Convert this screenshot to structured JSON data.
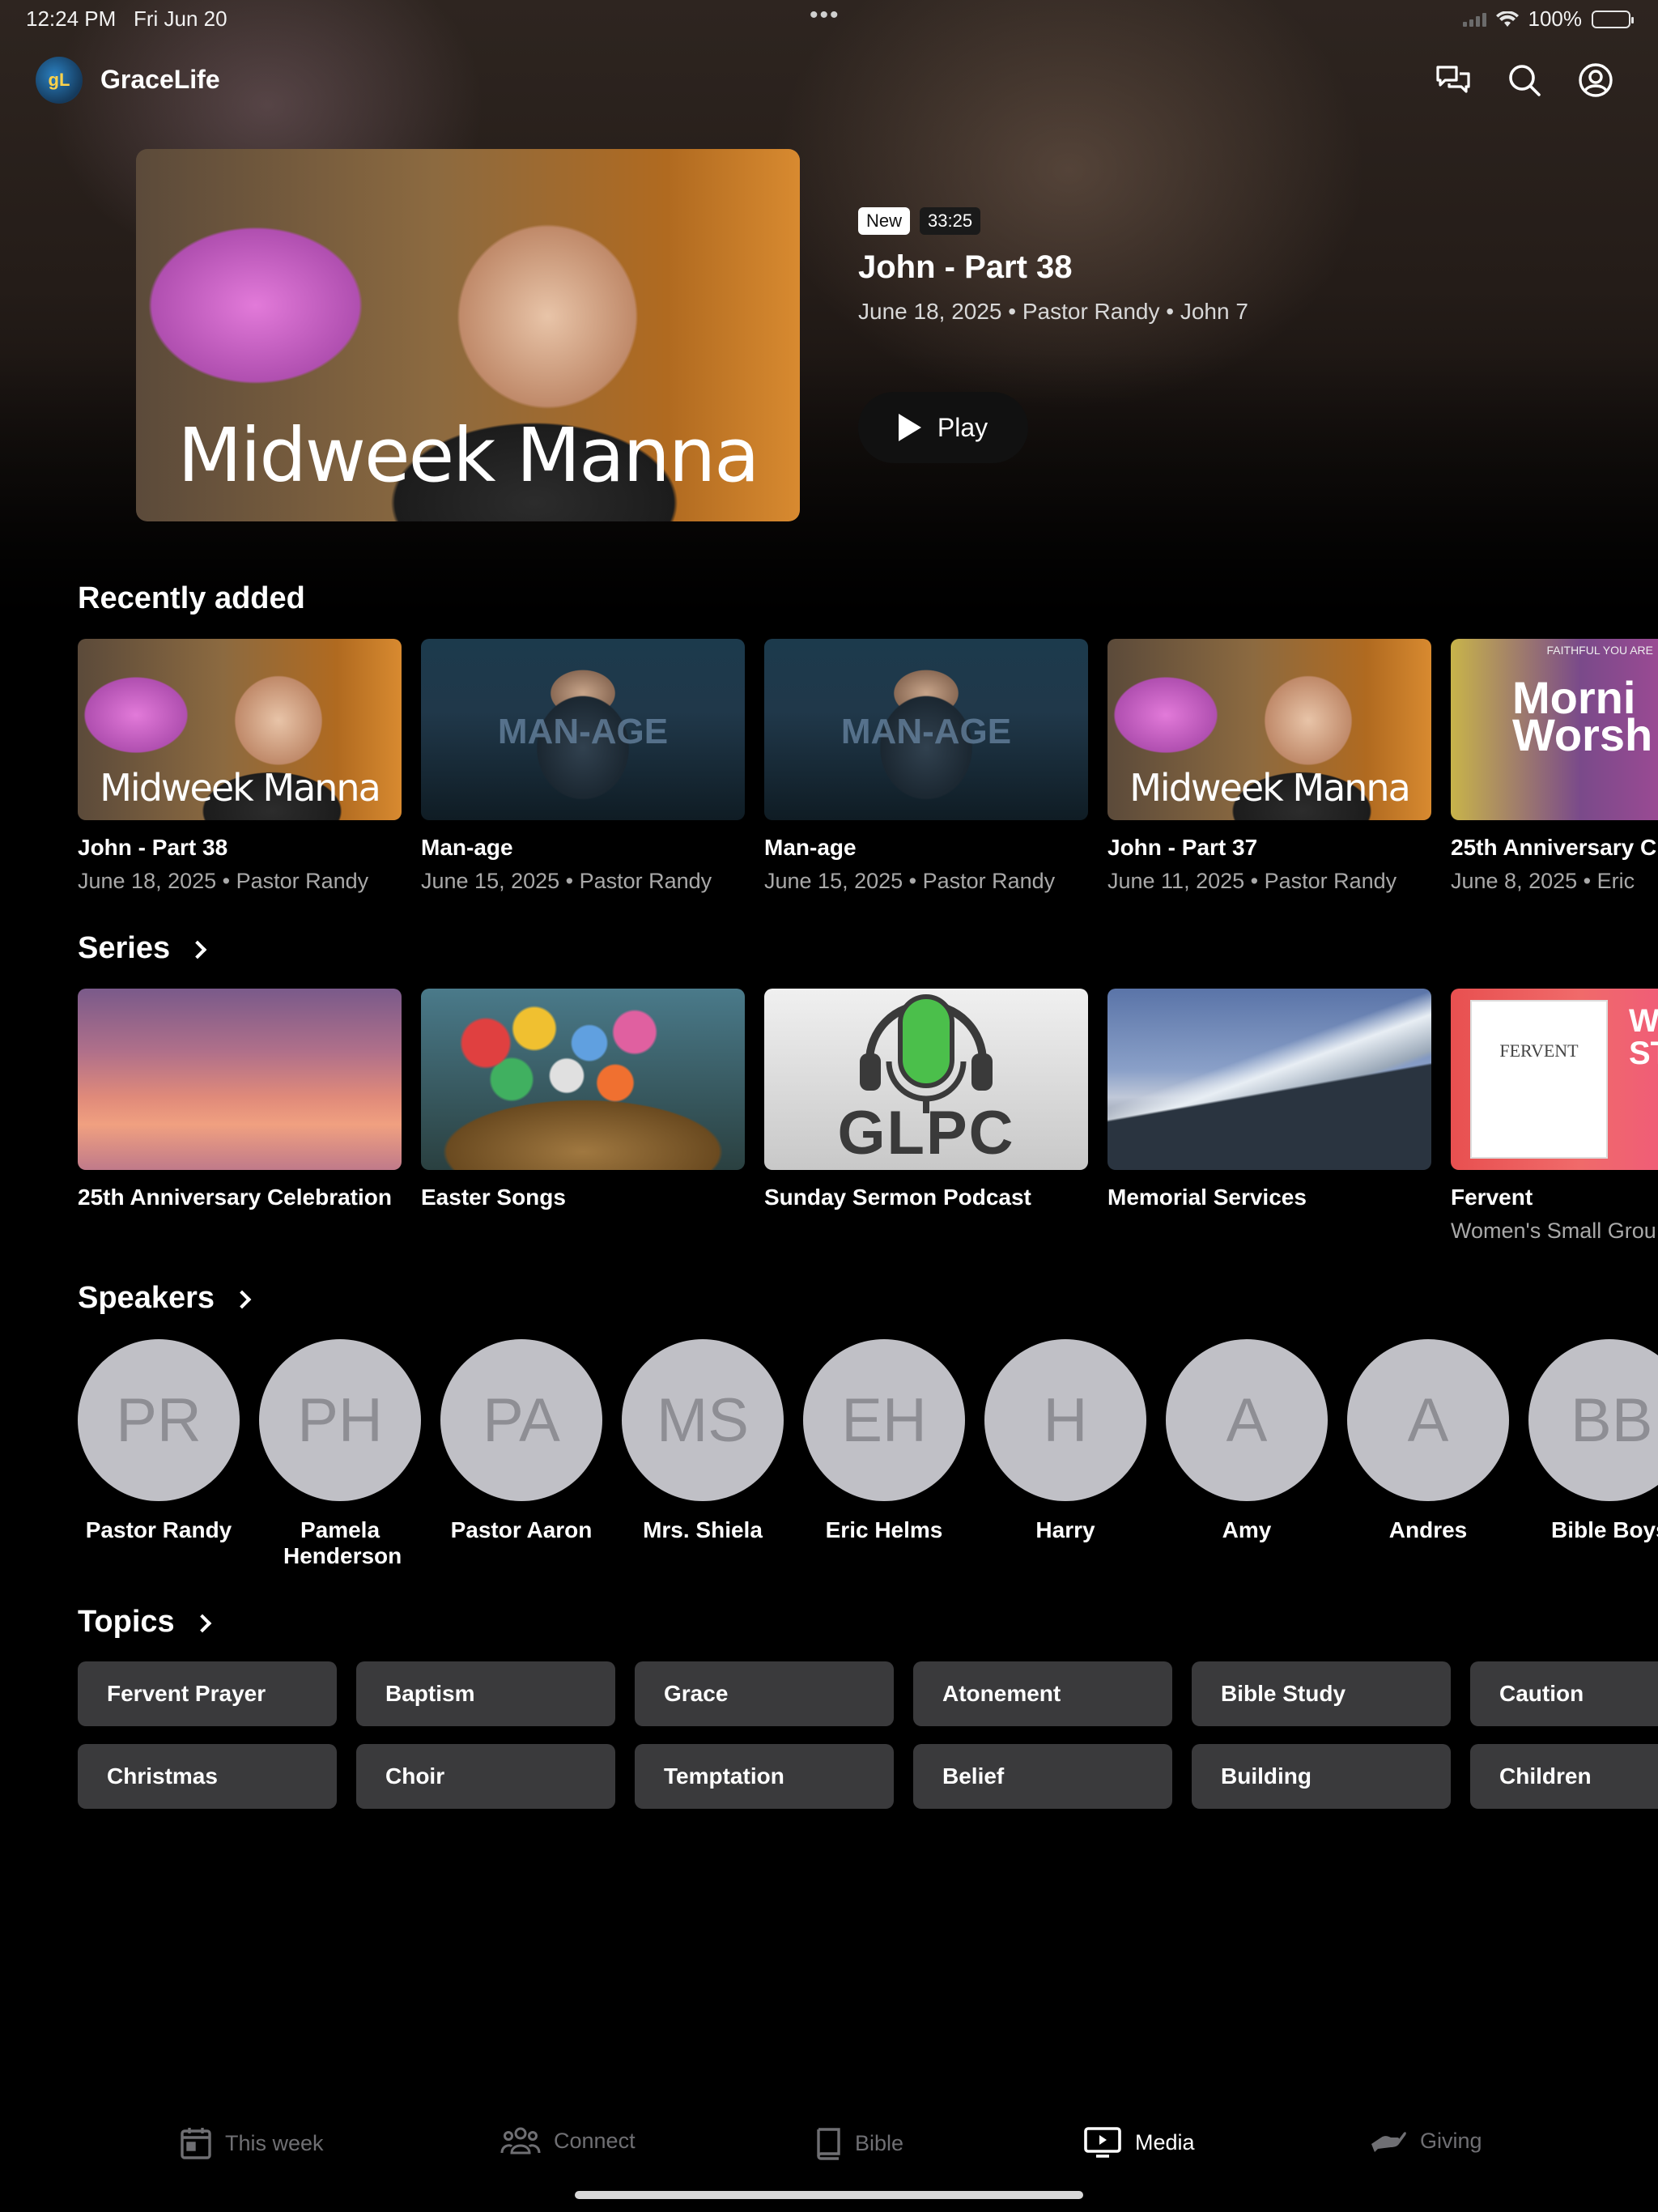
{
  "status_bar": {
    "time": "12:24 PM",
    "date": "Fri Jun 20",
    "battery": "100%",
    "battery_level": 1.0
  },
  "header": {
    "app_name": "GraceLife",
    "logo_text": "gL",
    "icons": [
      "chat-bubbles-icon",
      "search-icon",
      "account-icon"
    ]
  },
  "featured": {
    "badge_new": "New",
    "duration": "33:25",
    "title": "John - Part 38",
    "meta": "June 18, 2025 • Pastor Randy • John 7",
    "play_label": "Play",
    "thumb_text": "Midweek Manna"
  },
  "recently_added": {
    "title": "Recently added",
    "items": [
      {
        "title": "John - Part 38",
        "subtitle": "June 18, 2025 • Pastor Randy",
        "thumb_text": "Midweek Manna"
      },
      {
        "title": "Man-age",
        "subtitle": "June 15, 2025 • Pastor Randy",
        "thumb_text": "MAN-AGE"
      },
      {
        "title": "Man-age",
        "subtitle": "June 15, 2025 • Pastor Randy",
        "thumb_text": "MAN-AGE"
      },
      {
        "title": "John - Part 37",
        "subtitle": "June 11, 2025 • Pastor Randy",
        "thumb_text": "Midweek Manna"
      },
      {
        "title": "25th Anniversary C",
        "subtitle": "June 8, 2025 • Eric",
        "thumb_text": "Morni Worsh",
        "thumb_top": "FAITHFUL YOU ARE"
      }
    ]
  },
  "series": {
    "title": "Series",
    "items": [
      {
        "title": "25th Anniversary Celebration",
        "subtitle": ""
      },
      {
        "title": "Easter Songs",
        "subtitle": ""
      },
      {
        "title": "Sunday Sermon Podcast",
        "subtitle": "",
        "thumb_text": "GLPC"
      },
      {
        "title": "Memorial Services",
        "subtitle": ""
      },
      {
        "title": "Fervent",
        "subtitle": "Women's Small Grou",
        "thumb_text": "FERVENT",
        "thumb_side": "WO BO ST SUND"
      }
    ]
  },
  "speakers": {
    "title": "Speakers",
    "items": [
      {
        "initials": "PR",
        "name": "Pastor Randy"
      },
      {
        "initials": "PH",
        "name": "Pamela Henderson"
      },
      {
        "initials": "PA",
        "name": "Pastor Aaron"
      },
      {
        "initials": "MS",
        "name": "Mrs. Shiela"
      },
      {
        "initials": "EH",
        "name": "Eric Helms"
      },
      {
        "initials": "H",
        "name": "Harry"
      },
      {
        "initials": "A",
        "name": "Amy"
      },
      {
        "initials": "A",
        "name": "Andres"
      },
      {
        "initials": "BB",
        "name": "Bible Boys"
      }
    ]
  },
  "topics": {
    "title": "Topics",
    "items": [
      "Fervent Prayer",
      "Baptism",
      "Grace",
      "Atonement",
      "Bible Study",
      "Caution",
      "Christmas",
      "Choir",
      "Temptation",
      "Belief",
      "Building",
      "Children"
    ]
  },
  "tabbar": {
    "items": [
      {
        "label": "This week",
        "icon": "calendar-icon"
      },
      {
        "label": "Connect",
        "icon": "people-icon"
      },
      {
        "label": "Bible",
        "icon": "book-icon"
      },
      {
        "label": "Media",
        "icon": "tv-icon",
        "active": true
      },
      {
        "label": "Giving",
        "icon": "giving-hand-icon"
      }
    ]
  }
}
